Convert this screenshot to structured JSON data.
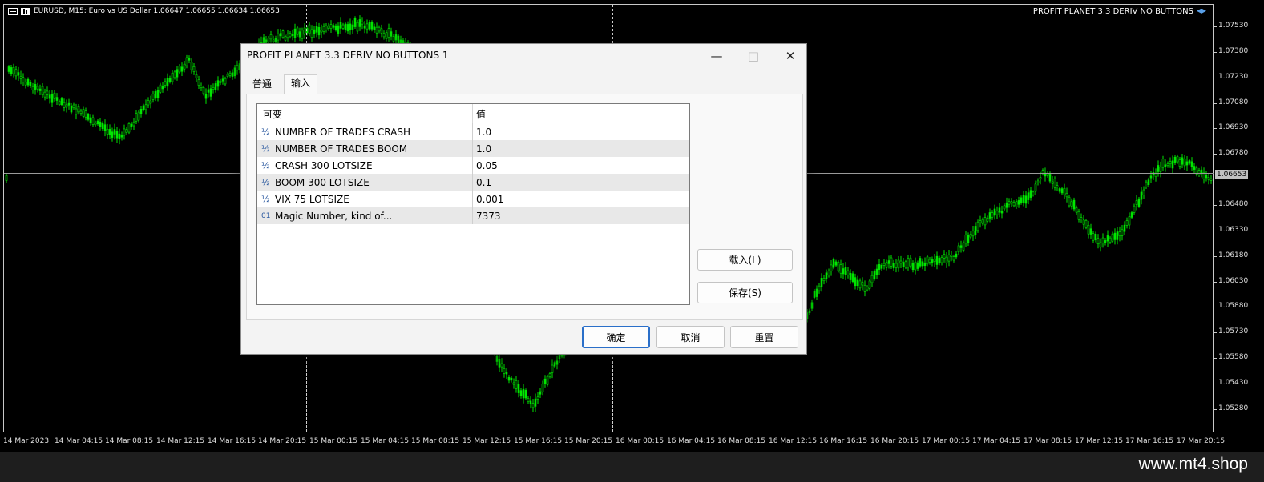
{
  "chart": {
    "symbol_info": "EURUSD, M15:  Euro vs US Dollar  1.06647 1.06655 1.06634 1.06653",
    "ea_name": "PROFIT PLANET 3.3 DERIV NO BUTTONS",
    "current_price": "1.06653",
    "price_labels": [
      "1.07530",
      "1.07380",
      "1.07230",
      "1.07080",
      "1.06930",
      "1.06780",
      "1.06480",
      "1.06330",
      "1.06180",
      "1.06030",
      "1.05880",
      "1.05730",
      "1.05580",
      "1.05430",
      "1.05280"
    ],
    "time_labels": [
      "14 Mar 2023",
      "14 Mar 04:15",
      "14 Mar 08:15",
      "14 Mar 12:15",
      "14 Mar 16:15",
      "14 Mar 20:15",
      "15 Mar 00:15",
      "15 Mar 04:15",
      "15 Mar 08:15",
      "15 Mar 12:15",
      "15 Mar 16:15",
      "15 Mar 20:15",
      "16 Mar 00:15",
      "16 Mar 04:15",
      "16 Mar 08:15",
      "16 Mar 12:15",
      "16 Mar 16:15",
      "16 Mar 20:15",
      "17 Mar 00:15",
      "17 Mar 04:15",
      "17 Mar 08:15",
      "17 Mar 12:15",
      "17 Mar 16:15",
      "17 Mar 20:15"
    ],
    "candle_color": "#00e600"
  },
  "dialog": {
    "title": "PROFIT PLANET 3.3 DERIV NO BUTTONS 1",
    "tabs": [
      "普通",
      "输入"
    ],
    "grid_headers": {
      "variable": "可变",
      "value": "值"
    },
    "params": [
      {
        "icon": "½",
        "name": "NUMBER OF TRADES CRASH",
        "value": "1.0"
      },
      {
        "icon": "½",
        "name": "NUMBER OF TRADES BOOM",
        "value": "1.0"
      },
      {
        "icon": "½",
        "name": "CRASH 300 LOTSIZE",
        "value": "0.05"
      },
      {
        "icon": "½",
        "name": "BOOM 300 LOTSIZE",
        "value": "0.1"
      },
      {
        "icon": "½",
        "name": "VIX 75 LOTSIZE",
        "value": "0.001"
      },
      {
        "icon": "01",
        "name": "Magic Number, kind of...",
        "value": "7373"
      }
    ],
    "load_label": "载入(L)",
    "save_label": "保存(S)",
    "ok_label": "确定",
    "cancel_label": "取消",
    "reset_label": "重置"
  },
  "watermark": "www.mt4.shop"
}
